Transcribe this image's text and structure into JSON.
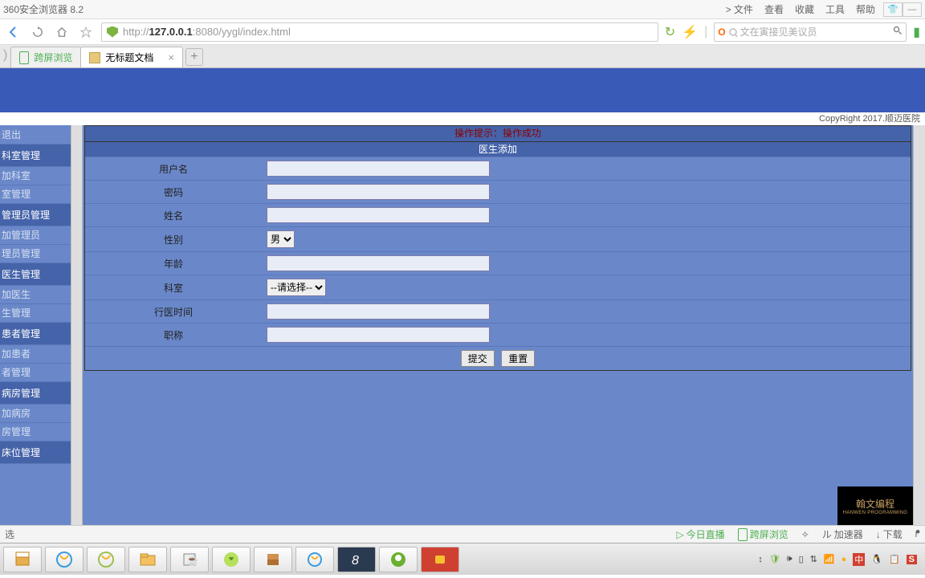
{
  "browser": {
    "title": "360安全浏览器 8.2",
    "menus": [
      "> 文件",
      "查看",
      "收藏",
      "工具",
      "帮助"
    ],
    "url_prefix": "http://",
    "url_host": "127.0.0.1",
    "url_rest": ":8080/yygl/index.html",
    "search_placeholder": "文在寅接见美议员"
  },
  "tabs": {
    "t1": "跨屏浏览",
    "t2": "无标题文档"
  },
  "copyright": "CopyRight 2017.顺迈医院",
  "sidebar": {
    "exit": "退出",
    "sec1": "科室管理",
    "i1a": "加科室",
    "i1b": "室管理",
    "sec2": "管理员管理",
    "i2a": "加管理员",
    "i2b": "理员管理",
    "sec3": "医生管理",
    "i3a": "加医生",
    "i3b": "生管理",
    "sec4": "患者管理",
    "i4a": "加患者",
    "i4b": "者管理",
    "sec5": "病房管理",
    "i5a": "加病房",
    "i5b": "房管理",
    "sec6": "床位管理"
  },
  "form": {
    "hdr": "操作提示：操作成功",
    "subhdr": "医生添加",
    "username": "用户名",
    "password": "密码",
    "name": "姓名",
    "gender": "性别",
    "gender_val": "男",
    "age": "年龄",
    "dept": "科室",
    "dept_val": "--请选择--",
    "years": "行医时间",
    "title": "职称",
    "submit": "提交",
    "reset": "重置"
  },
  "status": {
    "left": "选",
    "s1": "今日直播",
    "s2": "跨屏浏览",
    "s3": "加速器",
    "s4": "下载"
  },
  "watermark": {
    "l1": "翰文编程",
    "l2": "HANWEN PROGRAMMING"
  }
}
